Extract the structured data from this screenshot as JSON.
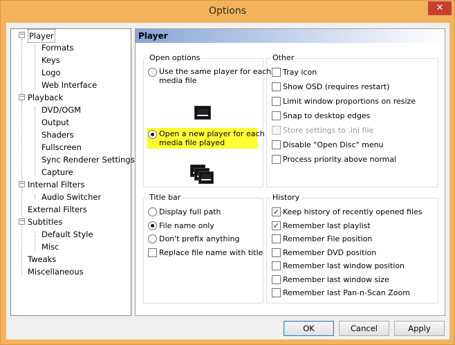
{
  "window": {
    "title": "Options",
    "close_glyph": "✕"
  },
  "tree": {
    "items": [
      {
        "label": "Player",
        "level": 0,
        "expander": "−",
        "selected": true
      },
      {
        "label": "Formats",
        "level": 1
      },
      {
        "label": "Keys",
        "level": 1
      },
      {
        "label": "Logo",
        "level": 1
      },
      {
        "label": "Web Interface",
        "level": 1
      },
      {
        "label": "Playback",
        "level": 0,
        "expander": "−"
      },
      {
        "label": "DVD/OGM",
        "level": 1
      },
      {
        "label": "Output",
        "level": 1
      },
      {
        "label": "Shaders",
        "level": 1
      },
      {
        "label": "Fullscreen",
        "level": 1
      },
      {
        "label": "Sync Renderer Settings",
        "level": 1
      },
      {
        "label": "Capture",
        "level": 1
      },
      {
        "label": "Internal Filters",
        "level": 0,
        "expander": "−"
      },
      {
        "label": "Audio Switcher",
        "level": 1
      },
      {
        "label": "External Filters",
        "level": 0
      },
      {
        "label": "Subtitles",
        "level": 0,
        "expander": "−"
      },
      {
        "label": "Default Style",
        "level": 1
      },
      {
        "label": "Misc",
        "level": 1
      },
      {
        "label": "Tweaks",
        "level": 0
      },
      {
        "label": "Miscellaneous",
        "level": 0
      }
    ]
  },
  "panel": {
    "header": "Player",
    "open_options": {
      "label": "Open options",
      "same_player": "Use the same player for each media file",
      "same_player_line1": "Use the same player for each",
      "same_player_line2": "media file",
      "new_player_line1": "Open a new player for each",
      "new_player_line2": "media file played",
      "selected": "new_player"
    },
    "other": {
      "label": "Other",
      "items": [
        {
          "label": "Tray icon",
          "checked": false,
          "disabled": false
        },
        {
          "label": "Show OSD (requires restart)",
          "checked": false,
          "disabled": false
        },
        {
          "label": "Limit window proportions on resize",
          "checked": false,
          "disabled": false
        },
        {
          "label": "Snap to desktop edges",
          "checked": false,
          "disabled": false
        },
        {
          "label": "Store settings to .ini file",
          "checked": false,
          "disabled": true
        },
        {
          "label": "Disable \"Open Disc\" menu",
          "checked": false,
          "disabled": false
        },
        {
          "label": "Process priority above normal",
          "checked": false,
          "disabled": false
        }
      ]
    },
    "title_bar": {
      "label": "Title bar",
      "radios": [
        {
          "label": "Display full path",
          "checked": false
        },
        {
          "label": "File name only",
          "checked": true
        },
        {
          "label": "Don't prefix anything",
          "checked": false
        }
      ],
      "checkbox": {
        "label": "Replace file name with title",
        "checked": false
      }
    },
    "history": {
      "label": "History",
      "items": [
        {
          "label": "Keep history of recently opened files",
          "checked": true
        },
        {
          "label": "Remember last playlist",
          "checked": true
        },
        {
          "label": "Remember File position",
          "checked": false
        },
        {
          "label": "Remember DVD position",
          "checked": false
        },
        {
          "label": "Remember last window position",
          "checked": false
        },
        {
          "label": "Remember last window size",
          "checked": false
        },
        {
          "label": "Remember last Pan-n-Scan Zoom",
          "checked": false
        }
      ]
    }
  },
  "buttons": {
    "ok": "OK",
    "cancel": "Cancel",
    "apply": "Apply"
  },
  "colors": {
    "titlebar": "#f3b25c",
    "close": "#c7402f",
    "highlight": "#ffff33",
    "header_gradient_start": "#8aa4d4"
  },
  "icons": {
    "close": "close-icon",
    "single_player": "player-window-icon",
    "multi_player": "multiple-player-windows-icon"
  }
}
